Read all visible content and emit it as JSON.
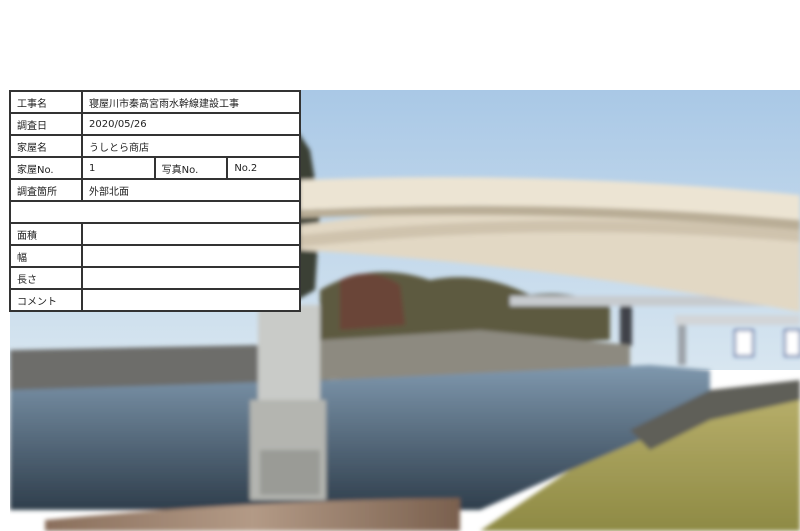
{
  "form": {
    "construction_name": {
      "label": "工事名",
      "value": "寝屋川市秦高宮雨水幹線建設工事"
    },
    "survey_date": {
      "label": "調査日",
      "value": "2020/05/26"
    },
    "house_name": {
      "label": "家屋名",
      "value": "うしとら商店"
    },
    "house_no": {
      "label": "家屋No.",
      "value": "1",
      "photo_label": "写真No.",
      "photo_value": "No.2"
    },
    "survey_location": {
      "label": "調査箇所",
      "value": "外部北面"
    },
    "area": {
      "label": "面積",
      "value": ""
    },
    "width": {
      "label": "幅",
      "value": ""
    },
    "length": {
      "label": "長さ",
      "value": ""
    },
    "comment": {
      "label": "コメント",
      "value": ""
    }
  },
  "colors": {
    "sky": "#bcd4ea",
    "bridge": "#e6ddcb",
    "water": "#5a7590",
    "grass": "#a8a458",
    "table_border": "#333333"
  }
}
